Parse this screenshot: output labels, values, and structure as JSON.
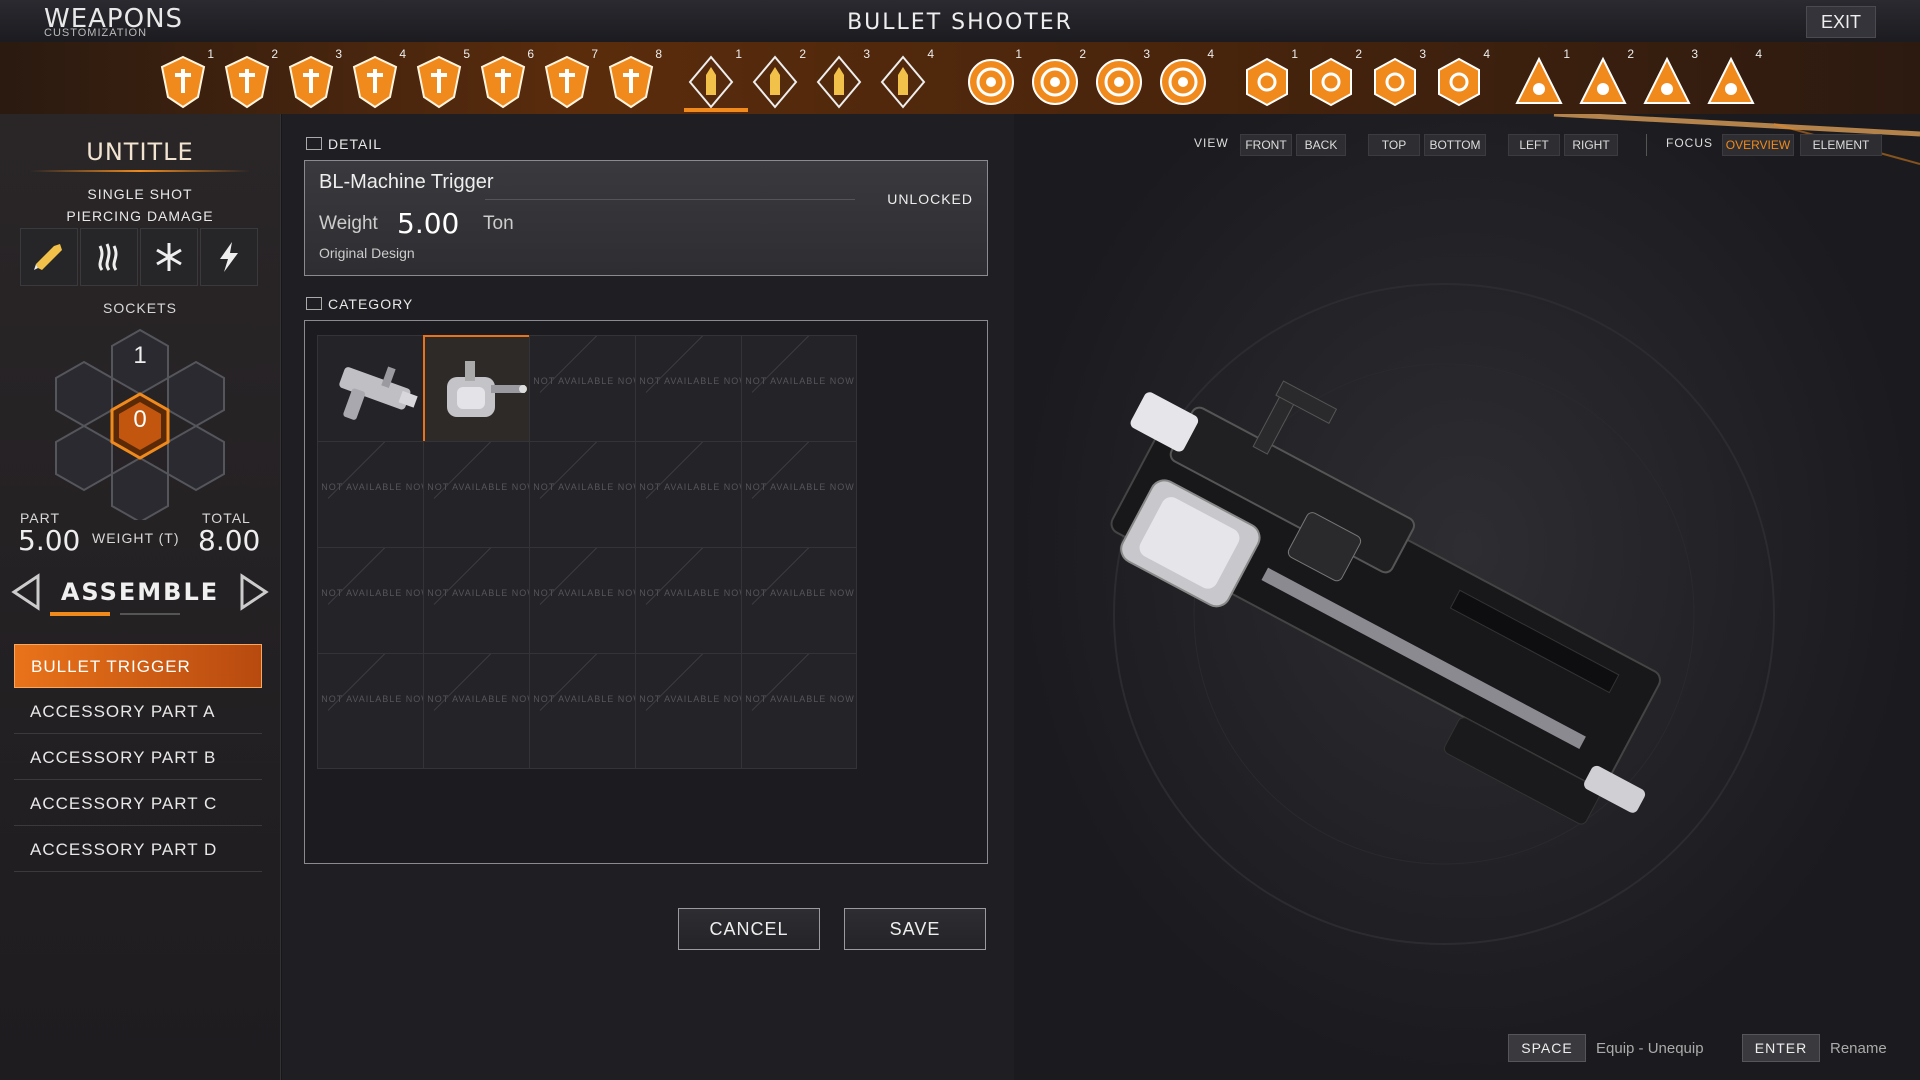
{
  "header": {
    "logo_main": "WEAPONS",
    "logo_sub": "CUSTOMIZATION",
    "title": "BULLET SHOOTER",
    "exit_label": "EXIT"
  },
  "slots": [
    {
      "group": "shield",
      "num": "1"
    },
    {
      "group": "shield",
      "num": "2"
    },
    {
      "group": "shield",
      "num": "3"
    },
    {
      "group": "shield",
      "num": "4"
    },
    {
      "group": "shield",
      "num": "5"
    },
    {
      "group": "shield",
      "num": "6"
    },
    {
      "group": "shield",
      "num": "7"
    },
    {
      "group": "shield",
      "num": "8"
    },
    {
      "group": "bullet",
      "num": "1"
    },
    {
      "group": "bullet",
      "num": "2"
    },
    {
      "group": "bullet",
      "num": "3"
    },
    {
      "group": "bullet",
      "num": "4"
    },
    {
      "group": "target",
      "num": "1"
    },
    {
      "group": "target",
      "num": "2"
    },
    {
      "group": "target",
      "num": "3"
    },
    {
      "group": "target",
      "num": "4"
    },
    {
      "group": "hex",
      "num": "1"
    },
    {
      "group": "hex",
      "num": "2"
    },
    {
      "group": "hex",
      "num": "3"
    },
    {
      "group": "hex",
      "num": "4"
    },
    {
      "group": "triangle",
      "num": "1"
    },
    {
      "group": "triangle",
      "num": "2"
    },
    {
      "group": "triangle",
      "num": "3"
    },
    {
      "group": "triangle",
      "num": "4"
    }
  ],
  "left": {
    "weapon_name": "UNTITLE",
    "shot_type": "SINGLE SHOT",
    "damage_type": "PIERCING DAMAGE",
    "damage_icons": [
      "bullet-icon",
      "heat-icon",
      "frost-icon",
      "lightning-icon"
    ],
    "sockets_label": "SOCKETS",
    "socket_top": "1",
    "socket_center": "0",
    "part_label": "PART",
    "part_value": "5.00",
    "weight_label": "WEIGHT (T)",
    "total_label": "TOTAL",
    "total_value": "8.00",
    "assemble_label": "ASSEMBLE",
    "parts": [
      "BULLET TRIGGER",
      "ACCESSORY PART A",
      "ACCESSORY PART B",
      "ACCESSORY PART C",
      "ACCESSORY PART D"
    ]
  },
  "detail": {
    "section_label": "DETAIL",
    "part_name": "BL-Machine Trigger",
    "status": "UNLOCKED",
    "weight_label": "Weight",
    "weight_value": "5.00",
    "weight_unit": "Ton",
    "origin": "Original Design"
  },
  "category": {
    "section_label": "CATEGORY",
    "not_available": "NOT AVAILABLE NOW"
  },
  "actions": {
    "cancel": "CANCEL",
    "save": "SAVE"
  },
  "view": {
    "view_label": "VIEW",
    "buttons": [
      "FRONT",
      "BACK",
      "TOP",
      "BOTTOM",
      "LEFT",
      "RIGHT"
    ],
    "focus_label": "FOCUS",
    "focus_buttons": [
      "OVERVIEW",
      "ELEMENT"
    ],
    "focus_active": "OVERVIEW"
  },
  "hints": {
    "space_key": "SPACE",
    "space_desc": "Equip - Unequip",
    "enter_key": "ENTER",
    "enter_desc": "Rename"
  },
  "colors": {
    "accent": "#f08a1c",
    "panel": "#1f1f23"
  }
}
